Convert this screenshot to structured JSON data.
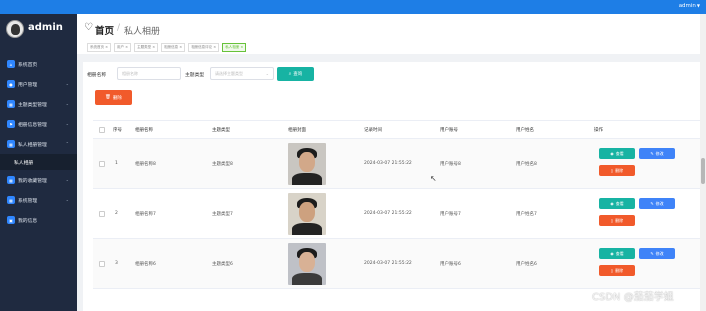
{
  "topbar": {
    "user": "admin"
  },
  "sidebar": {
    "brand": "admin",
    "items": [
      {
        "label": "系统首页",
        "icon": "home-icon"
      },
      {
        "label": "用户管理",
        "icon": "user-icon"
      },
      {
        "label": "主题类型管理",
        "icon": "grid-icon"
      },
      {
        "label": "相册信息管理",
        "icon": "flag-icon"
      },
      {
        "label": "私人相册管理",
        "icon": "grid-icon"
      },
      {
        "label": "私人相册",
        "icon": ""
      },
      {
        "label": "我的收藏管理",
        "icon": "grid-icon"
      },
      {
        "label": "系统管理",
        "icon": "grid-icon"
      },
      {
        "label": "我的信息",
        "icon": "card-icon"
      }
    ]
  },
  "header": {
    "home": "首页",
    "crumb": "私人相册",
    "tags": [
      "系统首页 ×",
      "用户 ×",
      "主题类型 ×",
      "相册信息 ×",
      "相册信息评论 ×",
      "私人相册 ×"
    ]
  },
  "filters": {
    "album_name_label": "相册名称",
    "album_name_placeholder": "相册名称",
    "theme_label": "主题类型",
    "theme_placeholder": "请选择主题类型",
    "search_label": "查询",
    "delete_label": "删除"
  },
  "table": {
    "headers": [
      "",
      "序号",
      "相册名称",
      "主题类型",
      "相册封面",
      "记录时间",
      "用户账号",
      "用户姓名",
      "操作"
    ],
    "rows": [
      {
        "index": "1",
        "album": "相册名称8",
        "theme": "主题类型8",
        "time": "2024-03-07 21:55:22",
        "account": "用户账号8",
        "name": "用户姓名8"
      },
      {
        "index": "2",
        "album": "相册名称7",
        "theme": "主题类型7",
        "time": "2024-03-07 21:55:22",
        "account": "用户账号7",
        "name": "用户姓名7"
      },
      {
        "index": "3",
        "album": "相册名称6",
        "theme": "主题类型6",
        "time": "2024-03-07 21:55:22",
        "account": "用户账号6",
        "name": "用户姓名6"
      }
    ],
    "actions": {
      "view": "查看",
      "edit": "修改",
      "delete": "删除"
    }
  },
  "watermark": "CSDN @茄茄学姐"
}
